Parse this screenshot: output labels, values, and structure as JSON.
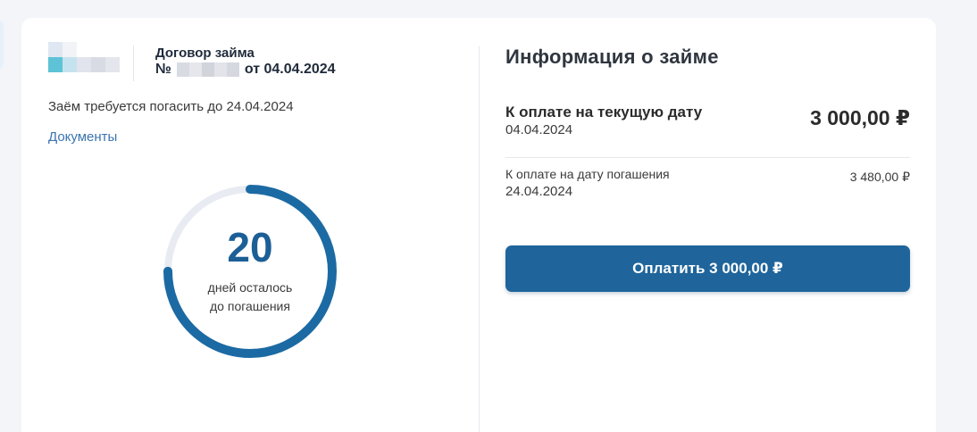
{
  "contract": {
    "title": "Договор займа",
    "number_prefix": "№",
    "date_text": "от 04.04.2024"
  },
  "repay_notice": "Заём требуется погасить до 24.04.2024",
  "documents_link": "Документы",
  "countdown": {
    "days": "20",
    "caption_line1": "дней осталось",
    "caption_line2": "до погашения",
    "progress_fraction": 0.75
  },
  "loan_info": {
    "title": "Информация о займе",
    "current": {
      "label": "К оплате на текущую дату",
      "date": "04.04.2024",
      "amount": "3 000,00 ₽"
    },
    "maturity": {
      "label": "К оплате на дату погашения",
      "date": "24.04.2024",
      "amount": "3 480,00 ₽"
    },
    "pay_button_label": "Оплатить 3 000,00 ₽"
  },
  "colors": {
    "accent": "#1f659b",
    "ring_track": "#e8ebf2",
    "ring_fill": "#1c6aa3",
    "link": "#3b74b0"
  }
}
